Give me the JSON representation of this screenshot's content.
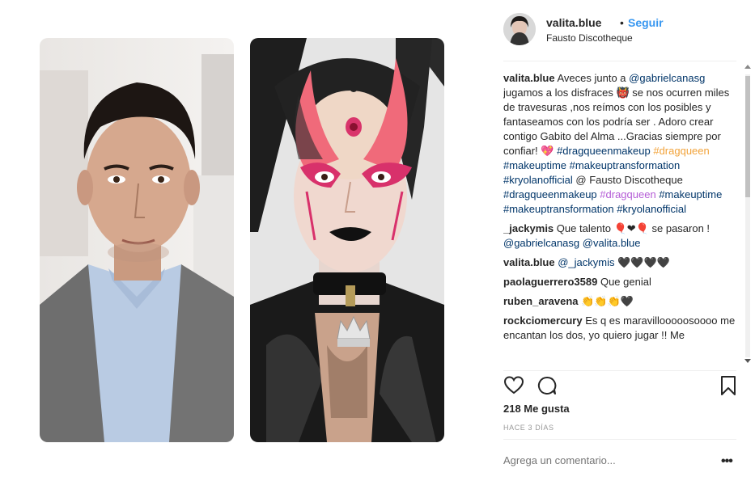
{
  "header": {
    "username": "valita.blue",
    "dot": "•",
    "follow_label": "Seguir",
    "location": "Fausto Discotheque"
  },
  "caption": {
    "user": "valita.blue",
    "text_1": "Aveces junto a",
    "mention_1": "@gabrielcanasg",
    "text_2": "jugamos a los disfraces 👹 se nos ocurren miles de travesuras ,nos reímos con los posibles y fantaseamos con los podría ser . Adoro crear contigo Gabito del Alma ...Gracias siempre por confiar! 💖",
    "tag_1": "#dragqueenmakeup",
    "tag_2": "#dragqueen",
    "tag_3": "#makeuptime",
    "tag_4": "#makeuptransformation",
    "tag_5": "#kryolanofficial",
    "text_3": "@ Fausto Discotheque",
    "tag_6": "#dragqueenmakeup",
    "tag_7": "#dragqueen",
    "tag_8": "#makeuptime",
    "tag_9": "#makeuptransformation",
    "tag_10": "#kryolanofficial"
  },
  "comments": [
    {
      "user": "_jackymis",
      "text": "Que talento 🎈❤🎈 se pasaron !",
      "mention_a": "@gabrielcanasg",
      "mention_b": "@valita.blue"
    },
    {
      "user": "valita.blue",
      "mention": "@_jackymis",
      "text": "🖤🖤🖤🖤"
    },
    {
      "user": "paolaguerrero3589",
      "text": "Que genial"
    },
    {
      "user": "ruben_aravena",
      "text": "👏👏👏🖤"
    },
    {
      "user": "rockciomercury",
      "text": "Es q es maravillooooosoooo me encantan los dos, yo quiero jugar !! Me"
    }
  ],
  "stats": {
    "likes": "218 Me gusta",
    "time": "HACE 3 DÍAS"
  },
  "add_comment": {
    "placeholder": "Agrega un comentario..."
  },
  "more_label": "•••",
  "icons": {
    "like": "heart-icon",
    "comment": "comment-bubble-icon",
    "save": "bookmark-icon"
  }
}
